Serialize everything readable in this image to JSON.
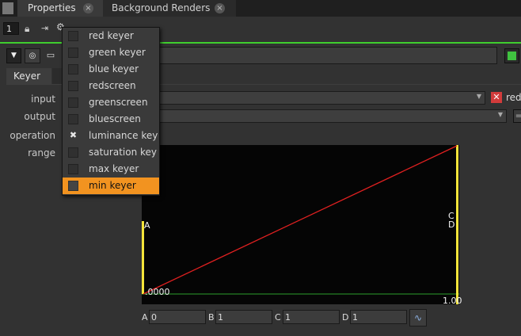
{
  "tabs": [
    {
      "label": "Properties",
      "close": "×"
    },
    {
      "label": "Background Renders",
      "close": "×"
    }
  ],
  "toolbar": {
    "node_count": "1"
  },
  "panel": {
    "tab_label": "Keyer"
  },
  "params": {
    "input_label": "input",
    "output_label": "output",
    "operation_label": "operation",
    "range_label": "range",
    "input_channel_label": "red"
  },
  "operation_menu": {
    "items": [
      {
        "label": "red keyer",
        "checked": false,
        "selected": false
      },
      {
        "label": "green keyer",
        "checked": false,
        "selected": false
      },
      {
        "label": "blue keyer",
        "checked": false,
        "selected": false
      },
      {
        "label": "redscreen",
        "checked": false,
        "selected": false
      },
      {
        "label": "greenscreen",
        "checked": false,
        "selected": false
      },
      {
        "label": "bluescreen",
        "checked": false,
        "selected": false
      },
      {
        "label": "luminance key",
        "checked": true,
        "selected": false
      },
      {
        "label": "saturation key",
        "checked": false,
        "selected": false
      },
      {
        "label": "max keyer",
        "checked": false,
        "selected": false
      },
      {
        "label": "min keyer",
        "checked": false,
        "selected": true
      }
    ],
    "check_glyph": "✖"
  },
  "curve": {
    "label_a": "A",
    "label_cd": "C\nD",
    "min_label": ".0000",
    "max_label": "1.00",
    "points": {
      "A": 0,
      "B": 1,
      "C": 1,
      "D": 1
    }
  },
  "range_fields": [
    {
      "label": "A",
      "value": "0"
    },
    {
      "label": "B",
      "value": "1"
    },
    {
      "label": "C",
      "value": "1"
    },
    {
      "label": "D",
      "value": "1"
    }
  ],
  "colors": {
    "accent_green": "#3fce2e",
    "menu_highlight": "#f29320",
    "curve_line": "#e02020",
    "range_bar": "#f5e53a"
  }
}
